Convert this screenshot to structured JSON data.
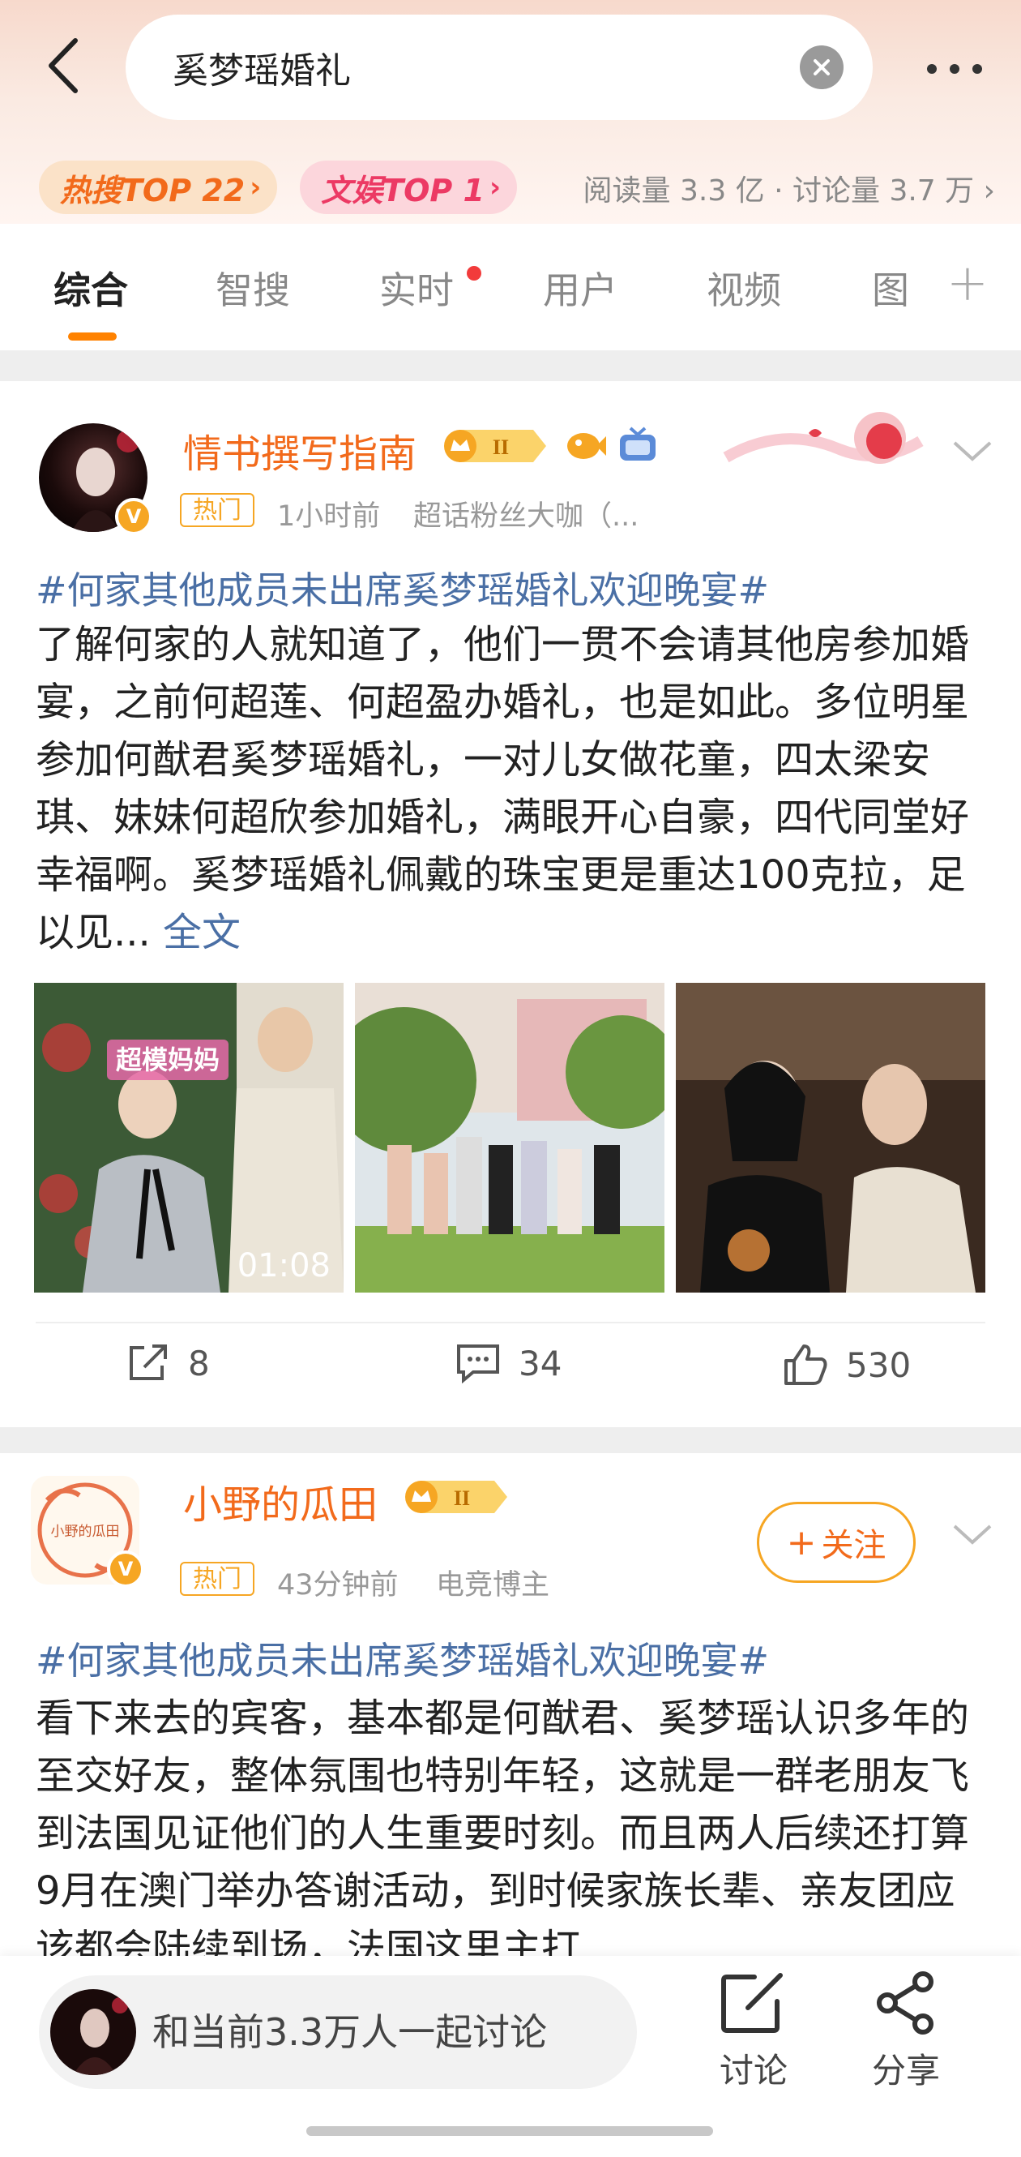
{
  "header": {
    "search_query": "奚梦瑶婚礼",
    "hot_rank_label": "热搜TOP 22",
    "ent_rank_label": "文娱TOP 1",
    "stats": "阅读量 3.3 亿 · 讨论量 3.7 万"
  },
  "tabs": [
    "综合",
    "智搜",
    "实时",
    "用户",
    "视频",
    "图"
  ],
  "posts": [
    {
      "username": "情书撰写指南",
      "tag": "热门",
      "time": "1小时前",
      "source": "超话粉丝大咖（...",
      "hashtag": "#何家其他成员未出席奚梦瑶婚礼欢迎晚宴#",
      "text": "了解何家的人就知道了，他们一贯不会请其他房参加婚宴，之前何超莲、何超盈办婚礼，也是如此。多位明星参加何猷君奚梦瑶婚礼，一对儿女做花童，四太梁安琪、妹妹何超欣参加婚礼，满眼开心自豪，四代同堂好幸福啊。奚梦瑶婚礼佩戴的珠宝更是重达100克拉，足以见...",
      "full_text_link": "全文",
      "images": [
        {
          "overlay": "超模妈妈",
          "duration": "01:08"
        },
        {},
        {}
      ],
      "reposts": "8",
      "comments": "34",
      "likes": "530"
    },
    {
      "username": "小野的瓜田",
      "avatar_text": "小野的瓜田",
      "tag": "热门",
      "time": "43分钟前",
      "source": "电竞博主",
      "follow_label": "关注",
      "hashtag": "#何家其他成员未出席奚梦瑶婚礼欢迎晚宴#",
      "text": "看下来去的宾客，基本都是何猷君、奚梦瑶认识多年的至交好友，整体氛围也特别年轻，这就是一群老朋友飞到法国见证他们的人生重要时刻。而且两人后续还打算9月在澳门举办答谢活动，到时候家族长辈、亲友团应该都会陆续到场，法国这里主打"
    }
  ],
  "bottom": {
    "join_text": "和当前3.3万人一起讨论",
    "discuss_label": "讨论",
    "share_label": "分享"
  }
}
